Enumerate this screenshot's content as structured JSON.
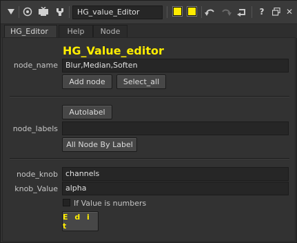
{
  "window": {
    "node_name_value": "HG_value_Editor",
    "icons": {
      "collapse": "triangle-down-icon",
      "node": "circle-target-icon",
      "viewer": "monitor-icon",
      "knob": "wrench-icon",
      "undo": "undo-icon",
      "redo": "redo-icon",
      "revert": "revert-icon",
      "help": "question-icon",
      "float": "float-window-icon",
      "close": "close-icon"
    },
    "help_glyph": "?",
    "close_glyph": "✕",
    "colors": {
      "swatch1": "#ffeb00",
      "swatch2": "#ffeb00"
    }
  },
  "tabs": [
    {
      "label": "HG_Editor",
      "active": true
    },
    {
      "label": "Help",
      "active": false
    },
    {
      "label": "Node",
      "active": false
    }
  ],
  "editor": {
    "heading": "HG_Value_editor",
    "node_name": {
      "label": "node_name",
      "value": "Blur,Median,Soften"
    },
    "add_node_label": "Add node",
    "select_all_label": "Select_all",
    "autolabel_label": "Autolabel",
    "node_labels": {
      "label": "node_labels",
      "value": ""
    },
    "all_node_by_label_label": "All Node By Label",
    "node_knob": {
      "label": "node_knob",
      "value": "channels"
    },
    "knob_value": {
      "label": "knob_Value",
      "value": "alpha"
    },
    "if_numbers_label": "If Value is numbers",
    "if_numbers_checked": false,
    "edit_label": "E d i t"
  }
}
